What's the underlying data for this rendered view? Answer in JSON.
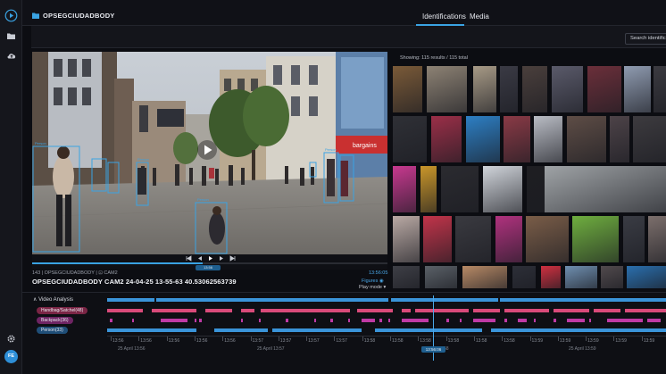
{
  "app": {
    "breadcrumb": "OPSEGCIUDADBODY",
    "tabs": [
      {
        "label": "Identifications",
        "active": true
      },
      {
        "label": "Media",
        "active": false
      }
    ],
    "search_button": "Search identific",
    "user_initials": "FE"
  },
  "sidebar": {
    "icons": [
      "play-circle-icon",
      "folder-icon",
      "cloud-upload-icon",
      "gear-icon"
    ]
  },
  "video": {
    "meta": "143  |  OPSEGCIUDADBODY   |  ⊡ CAM2",
    "time": "13:56:05",
    "title": "OPSEGCIUDADBODY CAM2 24-04-25 13-55-63 40.53062563739",
    "figures_label": "Figures",
    "playmode_label": "Play mode",
    "current_time_pill": "13:56",
    "progress": 0.48,
    "detection_label": "Person",
    "store_sign": "bargains"
  },
  "identifications": {
    "results_text": "Showing: 115 results / 115 total"
  },
  "timeline": {
    "section_label": "Video Analysis",
    "tracks": [
      {
        "label": "",
        "color": "#3a94d9"
      },
      {
        "label": "Handbag/Satchel(48)",
        "color": "#d94a7a"
      },
      {
        "label": "Backpack(36)",
        "color": "#c03aa5"
      },
      {
        "label": "Person(33)",
        "color": "#3a94d9"
      }
    ],
    "ticks": [
      "13:56",
      "13:56",
      "13:56",
      "13:56",
      "13:56",
      "13:57",
      "13:57",
      "13:57",
      "13:57",
      "13:58",
      "13:58",
      "13:58",
      "13:58",
      "13:58",
      "13:58",
      "13:59",
      "13:59",
      "13:59",
      "13:59",
      "13:59"
    ],
    "dates": [
      "25 April 13:56",
      "25 April 13:57",
      "25 April 13:58",
      "25 April 13:59"
    ],
    "cursor_label": "13:56:06"
  },
  "colors": {
    "accent": "#3aa3e3",
    "handbag": "#d94a7a",
    "backpack": "#c03aa5",
    "person": "#3a94d9"
  }
}
